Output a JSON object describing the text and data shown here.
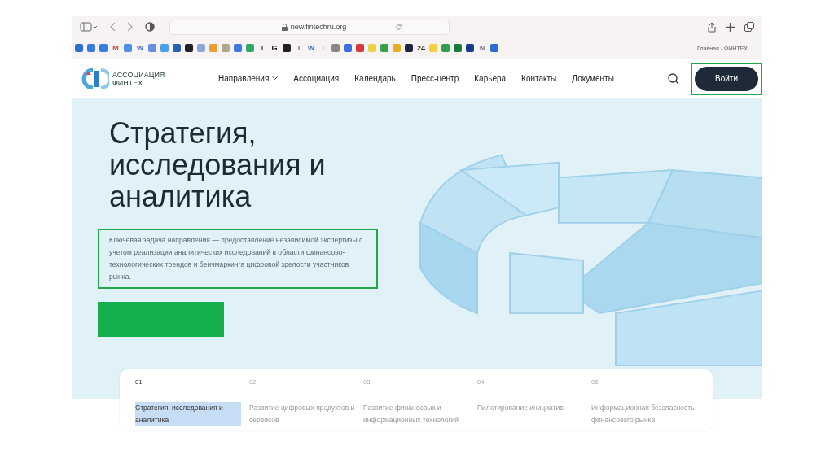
{
  "browser": {
    "url": "new.fintechru.org",
    "tab_title": "Главная - ФИНТЕХ",
    "bookmarks": [
      {
        "color": "#2a6fd6"
      },
      {
        "color": "#3a7be0"
      },
      {
        "color": "#3a7be0"
      },
      {
        "color": "#d94436",
        "label": "M"
      },
      {
        "color": "#4a8fe8"
      },
      {
        "color": "#3d6fd8",
        "label": "W"
      },
      {
        "color": "#6b8fe0"
      },
      {
        "color": "#4aa0e8"
      },
      {
        "color": "#2a5fb8"
      },
      {
        "color": "#222222"
      },
      {
        "color": "#8aa8d8"
      },
      {
        "color": "#e8a030"
      },
      {
        "color": "#b0a890"
      },
      {
        "color": "#3a7be0"
      },
      {
        "color": "#30a868"
      },
      {
        "color": "#1f4f9f",
        "label": "T"
      },
      {
        "color": "#111111",
        "label": "G"
      },
      {
        "color": "#222222"
      },
      {
        "color": "#777777",
        "label": "T"
      },
      {
        "color": "#4a6fd8",
        "label": "W"
      },
      {
        "color": "#e8c820",
        "label": "T"
      },
      {
        "color": "#888888"
      },
      {
        "color": "#3a6fd8"
      },
      {
        "color": "#d83a3a"
      },
      {
        "color": "#f0d040"
      },
      {
        "color": "#38a048"
      },
      {
        "color": "#e8b020"
      },
      {
        "color": "#222244"
      },
      {
        "color": "#333333",
        "label": "24"
      },
      {
        "color": "#f0d040"
      },
      {
        "color": "#2f9f4f"
      },
      {
        "color": "#1e7a3a"
      },
      {
        "color": "#1a3a8a"
      },
      {
        "color": "#777777",
        "label": "N"
      },
      {
        "color": "#2a6fd6"
      }
    ]
  },
  "site": {
    "logo_line1": "АССОЦИАЦИЯ",
    "logo_line2": "ФИНТЕХ",
    "nav": [
      {
        "label": "Направления",
        "dropdown": true
      },
      {
        "label": "Ассоциация",
        "dropdown": false
      },
      {
        "label": "Календарь",
        "dropdown": false
      },
      {
        "label": "Пресс-центр",
        "dropdown": false
      },
      {
        "label": "Карьера",
        "dropdown": false
      },
      {
        "label": "Контакты",
        "dropdown": false
      },
      {
        "label": "Документы",
        "dropdown": false
      }
    ],
    "login_button": "Войти"
  },
  "hero": {
    "title": "Стратегия, исследования и аналитика",
    "description": "Ключевая задача направления — предоставление независимой экспертизы с учетом реализации аналитических исследований в области финансово-технологических трендов и бенчмаркинга цифровой зрелости участников рынка."
  },
  "tabs": [
    {
      "number": "01",
      "label": "Стратегия, исследования и аналитика",
      "selected": true
    },
    {
      "number": "02",
      "label": "Развитие цифровых продуктов и сервисов",
      "selected": false
    },
    {
      "number": "03",
      "label": "Развитие финансовых и информационных технологий",
      "selected": false
    },
    {
      "number": "04",
      "label": "Пилотирование инициатив",
      "selected": false
    },
    {
      "number": "05",
      "label": "Информационная безопасность финансового рынка",
      "selected": false
    }
  ]
}
